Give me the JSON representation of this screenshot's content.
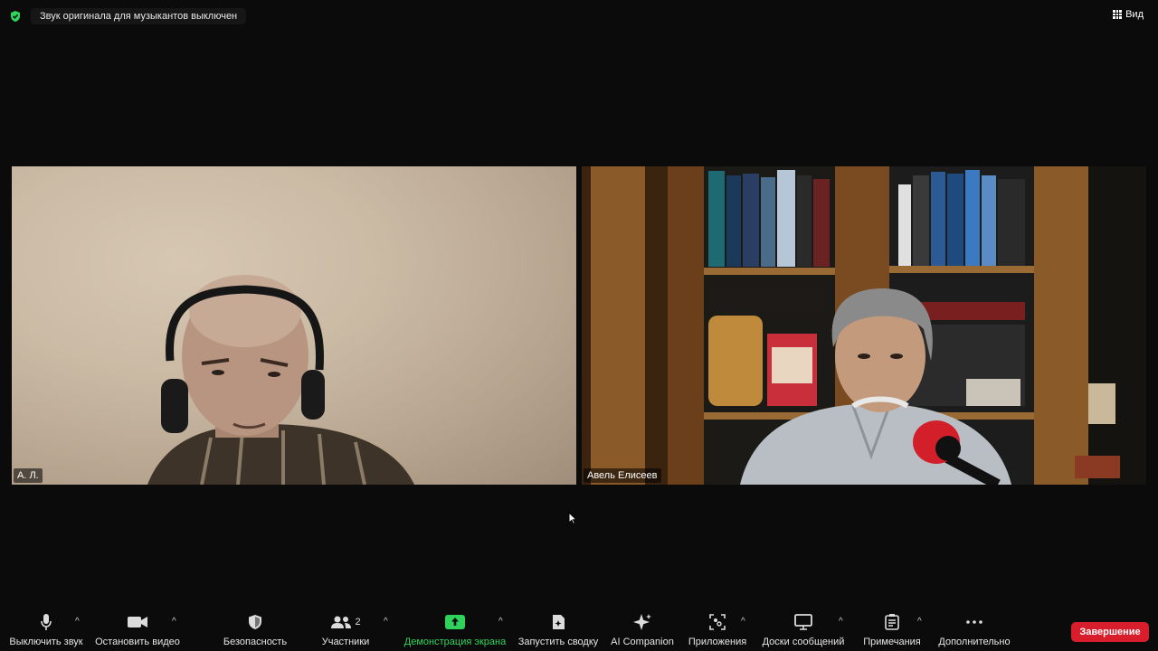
{
  "top": {
    "notice": "Звук оригинала для музыкантов выключен",
    "view_label": "Вид"
  },
  "participants": [
    {
      "name": "А. Л."
    },
    {
      "name": "Авель Елисеев"
    }
  ],
  "toolbar": {
    "mute_label": "Выключить звук",
    "video_label": "Остановить видео",
    "security_label": "Безопасность",
    "participants_label": "Участники",
    "participants_count": "2",
    "share_label": "Демонстрация экрана",
    "summary_label": "Запустить сводку",
    "ai_label": "AI Companion",
    "apps_label": "Приложения",
    "whiteboards_label": "Доски сообщений",
    "notes_label": "Примечания",
    "more_label": "Дополнительно",
    "end_label": "Завершение"
  },
  "colors": {
    "accent_green": "#2fd35c",
    "end_red": "#d81e2c",
    "background": "#0b0b0b"
  }
}
